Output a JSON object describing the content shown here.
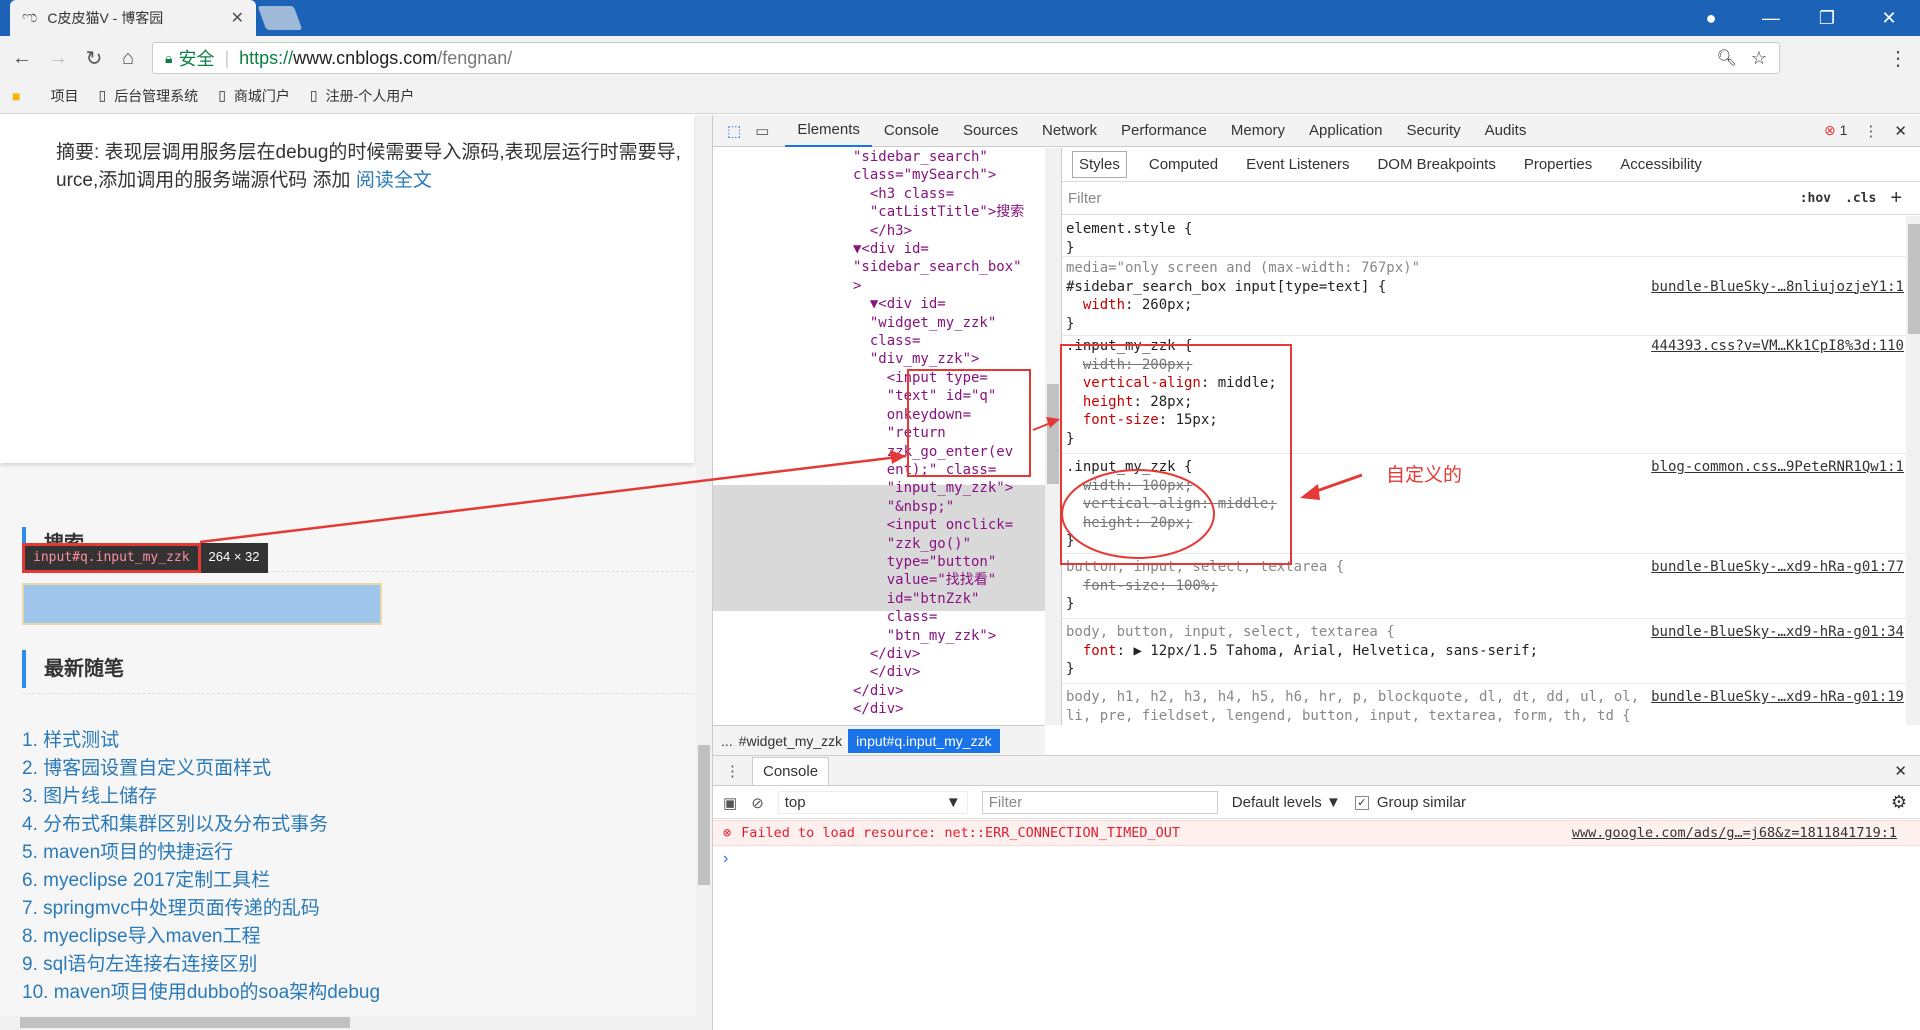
{
  "browser": {
    "tab_title": "C皮皮猫V - 博客园",
    "secure_label": "安全",
    "url_prefix": "https://",
    "url_domain": "www.cnblogs.com",
    "url_path": "/fengnan/",
    "bookmarks": [
      "项目",
      "后台管理系统",
      "商城门户",
      "注册-个人用户"
    ]
  },
  "page": {
    "summary_line1": "摘要: 表现层调用服务层在debug的时候需要导入源码,表现层运行时需要导,",
    "summary_line2": "urce,添加调用的服务端源代码 添加",
    "read_more": "阅读全文",
    "search_heading": "搜索",
    "latest_heading": "最新随笔",
    "posts": [
      "1. 样式测试",
      "2. 博客园设置自定义页面样式",
      "3. 图片线上储存",
      "4. 分布式和集群区别以及分布式事务",
      "5. maven项目的快捷运行",
      "6. myeclipse 2017定制工具栏",
      "7. springmvc中处理页面传递的乱码",
      "8. myeclipse导入maven工程",
      "9. sql语句左连接右连接区别",
      "10. maven项目使用dubbo的soa架构debug"
    ],
    "tooltip_element": "input#q.input_my_zzk",
    "tooltip_size": "264 × 32"
  },
  "devtools": {
    "tabs": [
      "Elements",
      "Console",
      "Sources",
      "Network",
      "Performance",
      "Memory",
      "Application",
      "Security",
      "Audits"
    ],
    "active_tab": "Elements",
    "error_count": "1",
    "dom_lines": [
      "\"sidebar_search\"",
      "class=\"mySearch\">",
      "  <h3 class=",
      "  \"catListTitle\">搜索",
      "  </h3>",
      "▼<div id=",
      "\"sidebar_search_box\"",
      ">",
      "  ▼<div id=",
      "  \"widget_my_zzk\"",
      "  class=",
      "  \"div_my_zzk\">",
      "    <input type=",
      "    \"text\" id=\"q\"",
      "    onkeydown=",
      "    \"return",
      "    zzk_go_enter(ev",
      "    ent);\" class=",
      "    \"input_my_zzk\">",
      "    \"&nbsp;\"",
      "    <input onclick=",
      "    \"zzk_go()\"",
      "    type=\"button\"",
      "    value=\"找找看\"",
      "    id=\"btnZzk\"",
      "    class=",
      "    \"btn_my_zzk\">",
      "  </div>",
      "  </div>",
      "</div>",
      "</div>"
    ],
    "breadcrumbs": [
      "...",
      "#widget_my_zzk",
      "input#q.input_my_zzk"
    ],
    "style_tabs": [
      "Styles",
      "Computed",
      "Event Listeners",
      "DOM Breakpoints",
      "Properties",
      "Accessibility"
    ],
    "filter_placeholder": "Filter",
    "hov": ":hov",
    "cls": ".cls",
    "rules": {
      "element_style": "element.style {",
      "media": "media=\"only screen and (max-width: 767px)\"",
      "r1_selector": "#sidebar_search_box input[type=text] {",
      "r1_prop": "width",
      "r1_val": "260px;",
      "r1_src": "bundle-BlueSky-…8nliujozjeY1:1",
      "r2_selector": ".input_my_zzk {",
      "r2_src": "444393.css?v=VM…Kk1CpI8%3d:110",
      "r2_props": [
        {
          "name": "width",
          "value": "200px;",
          "struck": true
        },
        {
          "name": "vertical-align",
          "value": "middle;",
          "struck": false
        },
        {
          "name": "height",
          "value": "28px;",
          "struck": false
        },
        {
          "name": "font-size",
          "value": "15px;",
          "struck": false
        }
      ],
      "r3_selector": ".input_my_zzk {",
      "r3_src": "blog-common.css…9PeteRNR1Qw1:1",
      "r3_props": [
        {
          "name": "width",
          "value": "100px;"
        },
        {
          "name": "vertical-align",
          "value": "middle;"
        },
        {
          "name": "height",
          "value": "20px;"
        }
      ],
      "r4_selector": "button, input, select, textarea {",
      "r4_prop": "font-size",
      "r4_val": "100%;",
      "r4_src": "bundle-BlueSky-…xd9-hRa-g01:77",
      "r5_selector": "body, button, input, select, textarea {",
      "r5_prop": "font",
      "r5_val": "▶ 12px/1.5 Tahoma, Arial, Helvetica, sans-serif;",
      "r5_src": "bundle-BlueSky-…xd9-hRa-g01:34",
      "r6_selector": "body, h1, h2, h3, h4, h5, h6, hr, p, blockquote, dl, dt, dd, ul, ol,",
      "r6_selector2": "li, pre, fieldset, lengend, button, input, textarea, form, th, td {",
      "r6_src": "bundle-BlueSky-…xd9-hRa-g01:19"
    },
    "annotation": "自定义的",
    "console": {
      "tab": "Console",
      "context": "top",
      "filter_placeholder": "Filter",
      "levels": "Default levels ▼",
      "group_similar": "Group similar",
      "error_message": "Failed to load resource: net::ERR_CONNECTION_TIMED_OUT",
      "error_source": "www.google.com/ads/g…=j68&z=1811841719:1"
    }
  },
  "colors": {
    "accent": "#1c63b7",
    "link": "#2a7ab9",
    "annotation": "#e53935"
  }
}
